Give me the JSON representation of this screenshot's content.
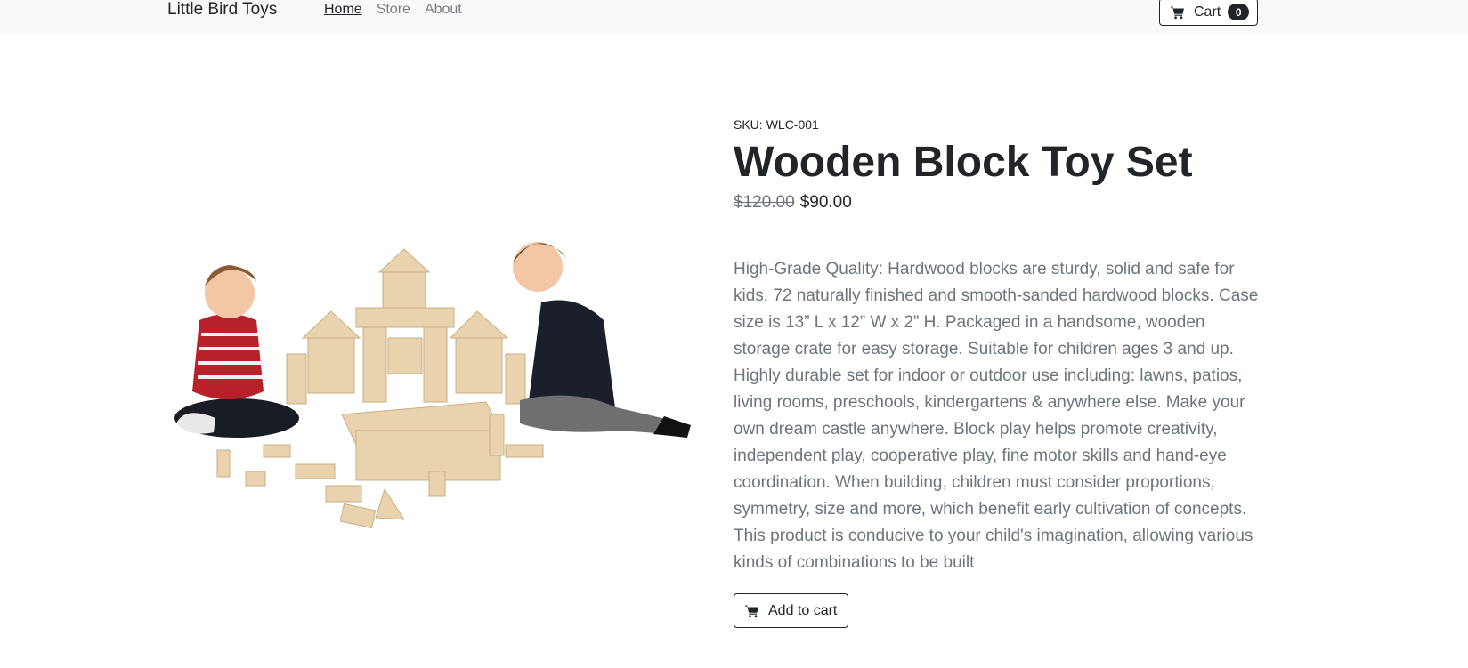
{
  "navbar": {
    "brand": "Little Bird Toys",
    "links": [
      {
        "label": "Home",
        "active": true
      },
      {
        "label": "Store",
        "active": false
      },
      {
        "label": "About",
        "active": false
      }
    ],
    "cart": {
      "label": "Cart",
      "count": "0",
      "icon": "cart-icon"
    }
  },
  "product": {
    "sku_label": "SKU:",
    "sku": "WLC-001",
    "name": "Wooden Block Toy Set",
    "price_original": "$120.00",
    "price_sale": "$90.00",
    "description": "High-Grade Quality: Hardwood blocks are sturdy, solid and safe for kids. 72 naturally finished and smooth-sanded hardwood blocks. Case size is 13” L x 12” W x 2” H. Packaged in a handsome, wooden storage crate for easy storage. Suitable for children ages 3 and up. Highly durable set for indoor or outdoor use including: lawns, patios, living rooms, preschools, kindergartens & anywhere else. Make your own dream castle anywhere. Block play helps promote creativity, independent play, cooperative play, fine motor skills and hand-eye coordination. When building, children must consider proportions, symmetry, size and more, which benefit early cultivation of concepts. This product is conducive to your child's imagination, allowing various kinds of combinations to be built",
    "add_to_cart_label": "Add to cart",
    "image_subject": "two children playing with wooden blocks"
  },
  "colors": {
    "navbar_bg": "#f8f9fa",
    "text": "#212529",
    "muted": "#6c757d",
    "badge_bg": "#212529"
  }
}
